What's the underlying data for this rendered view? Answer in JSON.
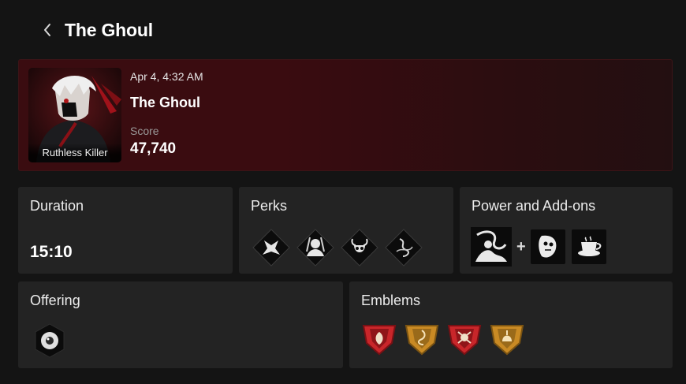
{
  "header": {
    "title": "The Ghoul",
    "back_icon": "chevron-left-icon"
  },
  "match": {
    "date": "Apr 4, 4:32 AM",
    "name": "The Ghoul",
    "score_label": "Score",
    "score": "47,740",
    "portrait_label": "Ruthless Killer"
  },
  "duration": {
    "title": "Duration",
    "value": "15:10"
  },
  "perks": {
    "title": "Perks",
    "items": [
      "perk-1-icon",
      "perk-2-icon",
      "perk-3-icon",
      "perk-4-icon"
    ]
  },
  "power": {
    "title": "Power and Add-ons",
    "power_icon": "power-icon",
    "plus": "+",
    "addons": [
      "addon-mask-icon",
      "addon-cup-icon"
    ]
  },
  "offering": {
    "title": "Offering",
    "icon": "offering-eye-icon"
  },
  "emblems": {
    "title": "Emblems",
    "items": [
      {
        "icon": "emblem-gatekeeper-icon",
        "color": "#c8262a"
      },
      {
        "icon": "emblem-devout-icon",
        "color": "#c98a24"
      },
      {
        "icon": "emblem-malicious-icon",
        "color": "#c8262a"
      },
      {
        "icon": "emblem-chaser-icon",
        "color": "#c98a24"
      }
    ]
  },
  "colors": {
    "background": "#141414",
    "card": "#232323",
    "hero": "#3a0c10"
  }
}
